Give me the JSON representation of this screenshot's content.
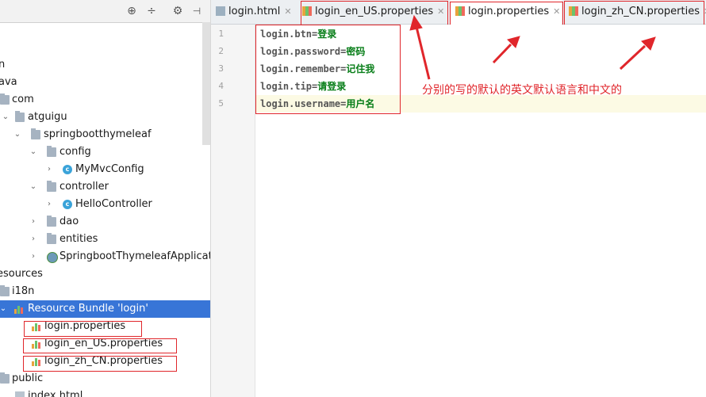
{
  "colors": {
    "annotation_red": "#e0262b",
    "selection_blue": "#3875d7",
    "value_green": "#067d17"
  },
  "left_toolbar": {
    "icons": [
      "crosshair-icon",
      "collapse-all-icon",
      "gear-icon",
      "hide-panel-icon"
    ]
  },
  "tree": {
    "items": [
      {
        "label": "n",
        "icon": "none"
      },
      {
        "label": "ava",
        "icon": "none"
      },
      {
        "label": "com",
        "icon": "folder"
      },
      {
        "label": "atguigu",
        "icon": "folder"
      },
      {
        "label": "springbootthymeleaf",
        "icon": "folder"
      },
      {
        "label": "config",
        "icon": "folder"
      },
      {
        "label": "MyMvcConfig",
        "icon": "class"
      },
      {
        "label": "controller",
        "icon": "folder"
      },
      {
        "label": "HelloController",
        "icon": "class"
      },
      {
        "label": "dao",
        "icon": "folder"
      },
      {
        "label": "entities",
        "icon": "folder"
      },
      {
        "label": "SpringbootThymeleafApplicatio",
        "icon": "spring-class"
      },
      {
        "label": "esources",
        "icon": "none"
      },
      {
        "label": "i18n",
        "icon": "folder"
      },
      {
        "label": "Resource Bundle 'login'",
        "icon": "resource-bundle",
        "selected": true
      },
      {
        "label": "login.properties",
        "icon": "properties"
      },
      {
        "label": "login_en_US.properties",
        "icon": "properties"
      },
      {
        "label": "login_zh_CN.properties",
        "icon": "properties"
      },
      {
        "label": "public",
        "icon": "folder"
      },
      {
        "label": "index.html",
        "icon": "html"
      }
    ]
  },
  "tabs": [
    {
      "label": "login.html",
      "icon": "html-file-icon"
    },
    {
      "label": "login_en_US.properties",
      "icon": "properties-file-icon"
    },
    {
      "label": "login.properties",
      "icon": "properties-file-icon",
      "active": true
    },
    {
      "label": "login_zh_CN.properties",
      "icon": "properties-file-icon"
    }
  ],
  "editor": {
    "lines": [
      {
        "num": "1",
        "key": "login.btn",
        "eq": "=",
        "value": "登录"
      },
      {
        "num": "2",
        "key": "login.password",
        "eq": "=",
        "value": "密码"
      },
      {
        "num": "3",
        "key": "login.remember",
        "eq": "=",
        "value": "记住我"
      },
      {
        "num": "4",
        "key": "login.tip",
        "eq": "=",
        "value": "请登录"
      },
      {
        "num": "5",
        "key": "login.username",
        "eq": "=",
        "value": "用户名"
      }
    ]
  },
  "annotation": {
    "text": "分别的写的默认的英文默认语言和中文的"
  }
}
